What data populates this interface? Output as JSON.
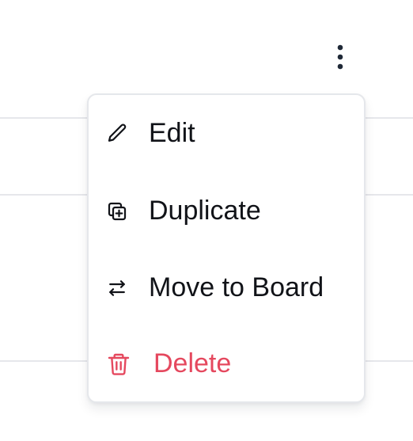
{
  "colors": {
    "text": "#111318",
    "danger": "#e5485e",
    "divider": "#e6e7eb",
    "menu_border": "#e5e7eb"
  },
  "kebab": {
    "icon": "more-vertical-icon"
  },
  "menu": {
    "items": [
      {
        "label": "Edit",
        "icon": "pencil-icon"
      },
      {
        "label": "Duplicate",
        "icon": "duplicate-icon"
      },
      {
        "label": "Move to Board",
        "icon": "swap-arrows-icon"
      },
      {
        "label": "Delete",
        "icon": "trash-icon",
        "danger": true
      }
    ]
  }
}
